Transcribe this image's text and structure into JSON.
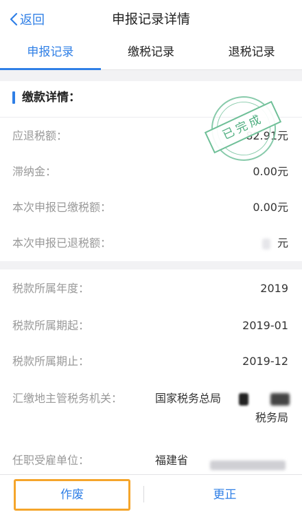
{
  "nav": {
    "back_label": "返回",
    "title": "申报记录详情"
  },
  "tabs": [
    {
      "label": "申报记录",
      "active": true
    },
    {
      "label": "缴税记录",
      "active": false
    },
    {
      "label": "退税记录",
      "active": false
    }
  ],
  "payment": {
    "title": "缴款详情：",
    "stamp_text": "已完成",
    "rows": [
      {
        "label": "应退税额：",
        "value": "82.91元"
      },
      {
        "label": "滞纳金：",
        "value": "0.00元"
      },
      {
        "label": "本次申报已缴税额：",
        "value": "0.00元"
      },
      {
        "label": "本次申报已退税额：",
        "value": "元"
      }
    ]
  },
  "tax_info": {
    "rows": [
      {
        "label": "税款所属年度：",
        "value": "2019"
      },
      {
        "label": "税款所属期起：",
        "value": "2019-01"
      },
      {
        "label": "税款所属期止：",
        "value": "2019-12"
      },
      {
        "label": "汇缴地主管税务机关：",
        "value_line1": "国家税务总局",
        "value_line2": "税务局"
      },
      {
        "label": "任职受雇单位：",
        "value": "福建省"
      }
    ]
  },
  "actions": {
    "void_label": "作废",
    "correct_label": "更正"
  },
  "colors": {
    "accent": "#2f7fe6",
    "highlight": "#f5a52b",
    "stamp": "#6ebf97"
  },
  "icons": {
    "back": "chevron-left-icon"
  }
}
